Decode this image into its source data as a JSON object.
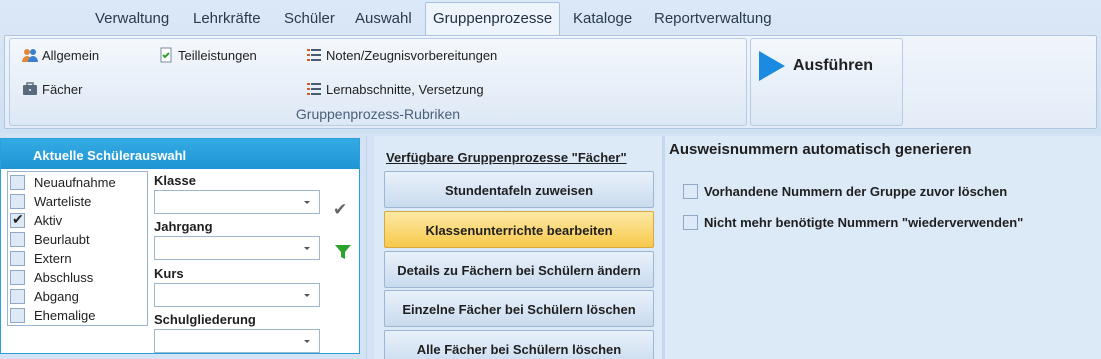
{
  "ribbon": {
    "tabs": [
      "Verwaltung",
      "Lehrkräfte",
      "Schüler",
      "Auswahl",
      "Gruppenprozesse",
      "Kataloge",
      "Reportverwaltung"
    ],
    "active_tab": "Gruppenprozesse",
    "group_label": "Gruppenprozess-Rubriken",
    "buttons": {
      "allgemein": "Allgemein",
      "faecher": "Fächer",
      "teilleistungen": "Teilleistungen",
      "noten": "Noten/Zeugnisvorbereitungen",
      "lernabschnitte": "Lernabschnitte, Versetzung"
    },
    "run_label": "Ausführen"
  },
  "selection": {
    "header": "Aktuelle Schülerauswahl",
    "statuses": [
      {
        "label": "Neuaufnahme",
        "checked": false
      },
      {
        "label": "Warteliste",
        "checked": false
      },
      {
        "label": "Aktiv",
        "checked": true
      },
      {
        "label": "Beurlaubt",
        "checked": false
      },
      {
        "label": "Extern",
        "checked": false
      },
      {
        "label": "Abschluss",
        "checked": false
      },
      {
        "label": "Abgang",
        "checked": false
      },
      {
        "label": "Ehemalige",
        "checked": false
      }
    ],
    "fields": {
      "klasse": "Klasse",
      "jahrgang": "Jahrgang",
      "kurs": "Kurs",
      "schulgliederung": "Schulgliederung"
    }
  },
  "middle": {
    "title": "Verfügbare Gruppenprozesse \"Fächer\"",
    "buttons": [
      "Stundentafeln zuweisen",
      "Klassenunterrichte bearbeiten",
      "Details zu Fächern bei Schülern ändern",
      "Einzelne Fächer bei Schülern löschen",
      "Alle Fächer bei Schülern löschen"
    ],
    "active_button": "Klassenunterrichte bearbeiten"
  },
  "right": {
    "title": "Ausweisnummern automatisch generieren",
    "options": [
      "Vorhandene Nummern der Gruppe zuvor löschen",
      "Nicht mehr benötigte Nummern \"wiederverwenden\""
    ]
  },
  "colors": {
    "accent": "#1e95d3",
    "active_button": "#f7c94b",
    "check_green": "#2aa52a"
  },
  "icons": {
    "allgemein": "users-icon",
    "faecher": "briefcase-icon",
    "teilleistungen": "document-check-icon",
    "noten": "list-icon",
    "lernabschnitte": "list-icon",
    "run": "play-icon",
    "apply": "check-icon",
    "filter": "filter-icon"
  }
}
